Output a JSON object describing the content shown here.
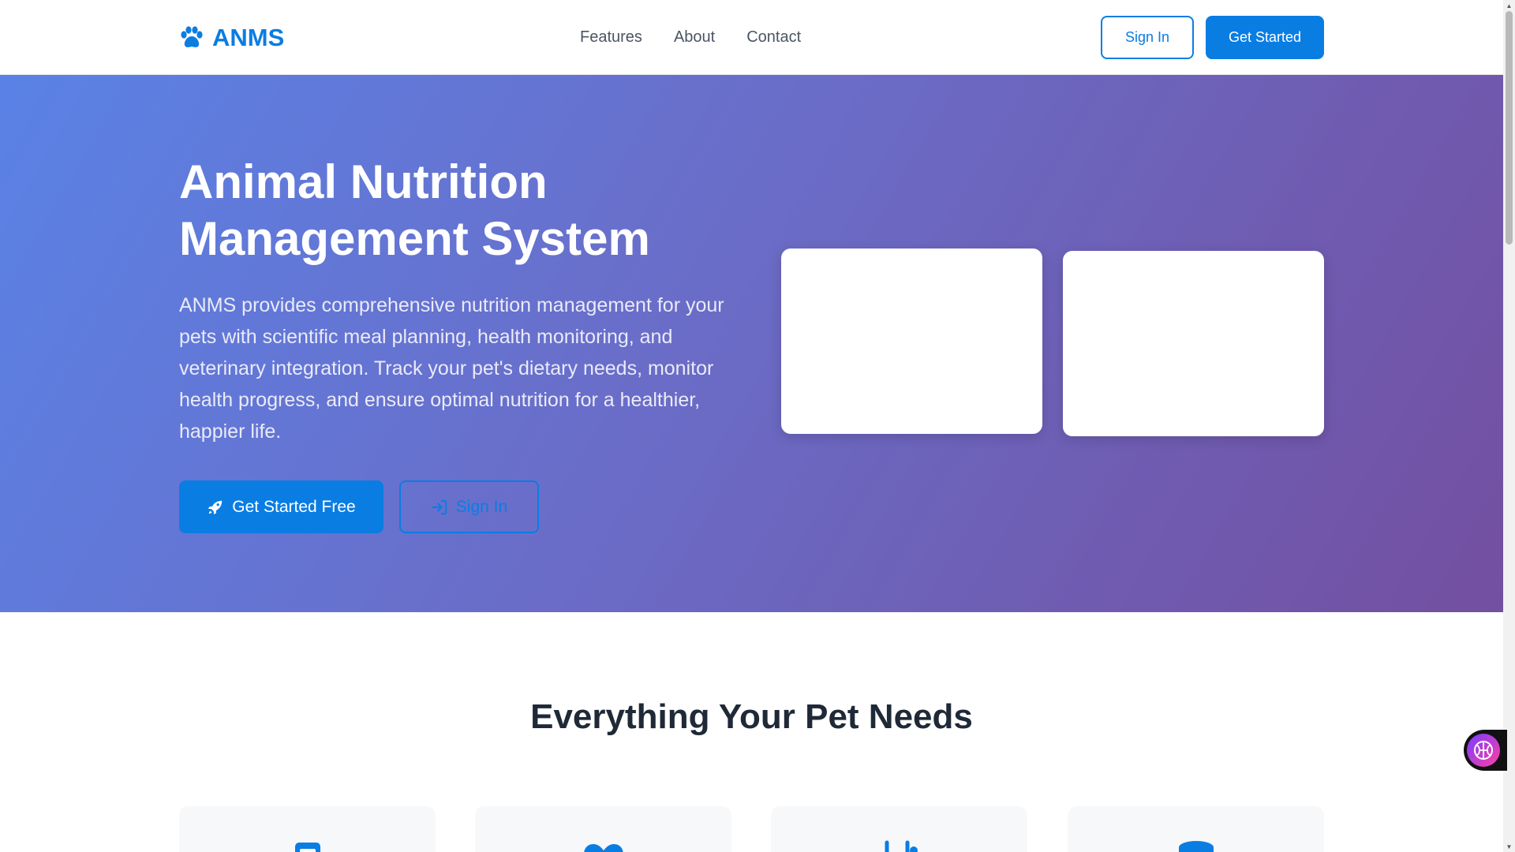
{
  "brand": {
    "name": "ANMS"
  },
  "nav": {
    "items": [
      "Features",
      "About",
      "Contact"
    ]
  },
  "header_actions": {
    "sign_in": "Sign In",
    "get_started": "Get Started"
  },
  "hero": {
    "title": "Animal Nutrition Management System",
    "description": "ANMS provides comprehensive nutrition management for your pets with scientific meal planning, health monitoring, and veterinary integration. Track your pet's dietary needs, monitor health progress, and ensure optimal nutrition for a healthier, happier life.",
    "primary_button": "Get Started Free",
    "secondary_button": "Sign In"
  },
  "features": {
    "title": "Everything Your Pet Needs"
  },
  "colors": {
    "accent": "#0a7de3",
    "hero_start": "#5a82e6",
    "hero_end": "#734fa0"
  },
  "icons": [
    "paw-icon",
    "rocket-icon",
    "sign-in-icon",
    "clipboard-icon",
    "heart-icon",
    "stethoscope-icon",
    "database-icon",
    "brain-icon"
  ]
}
